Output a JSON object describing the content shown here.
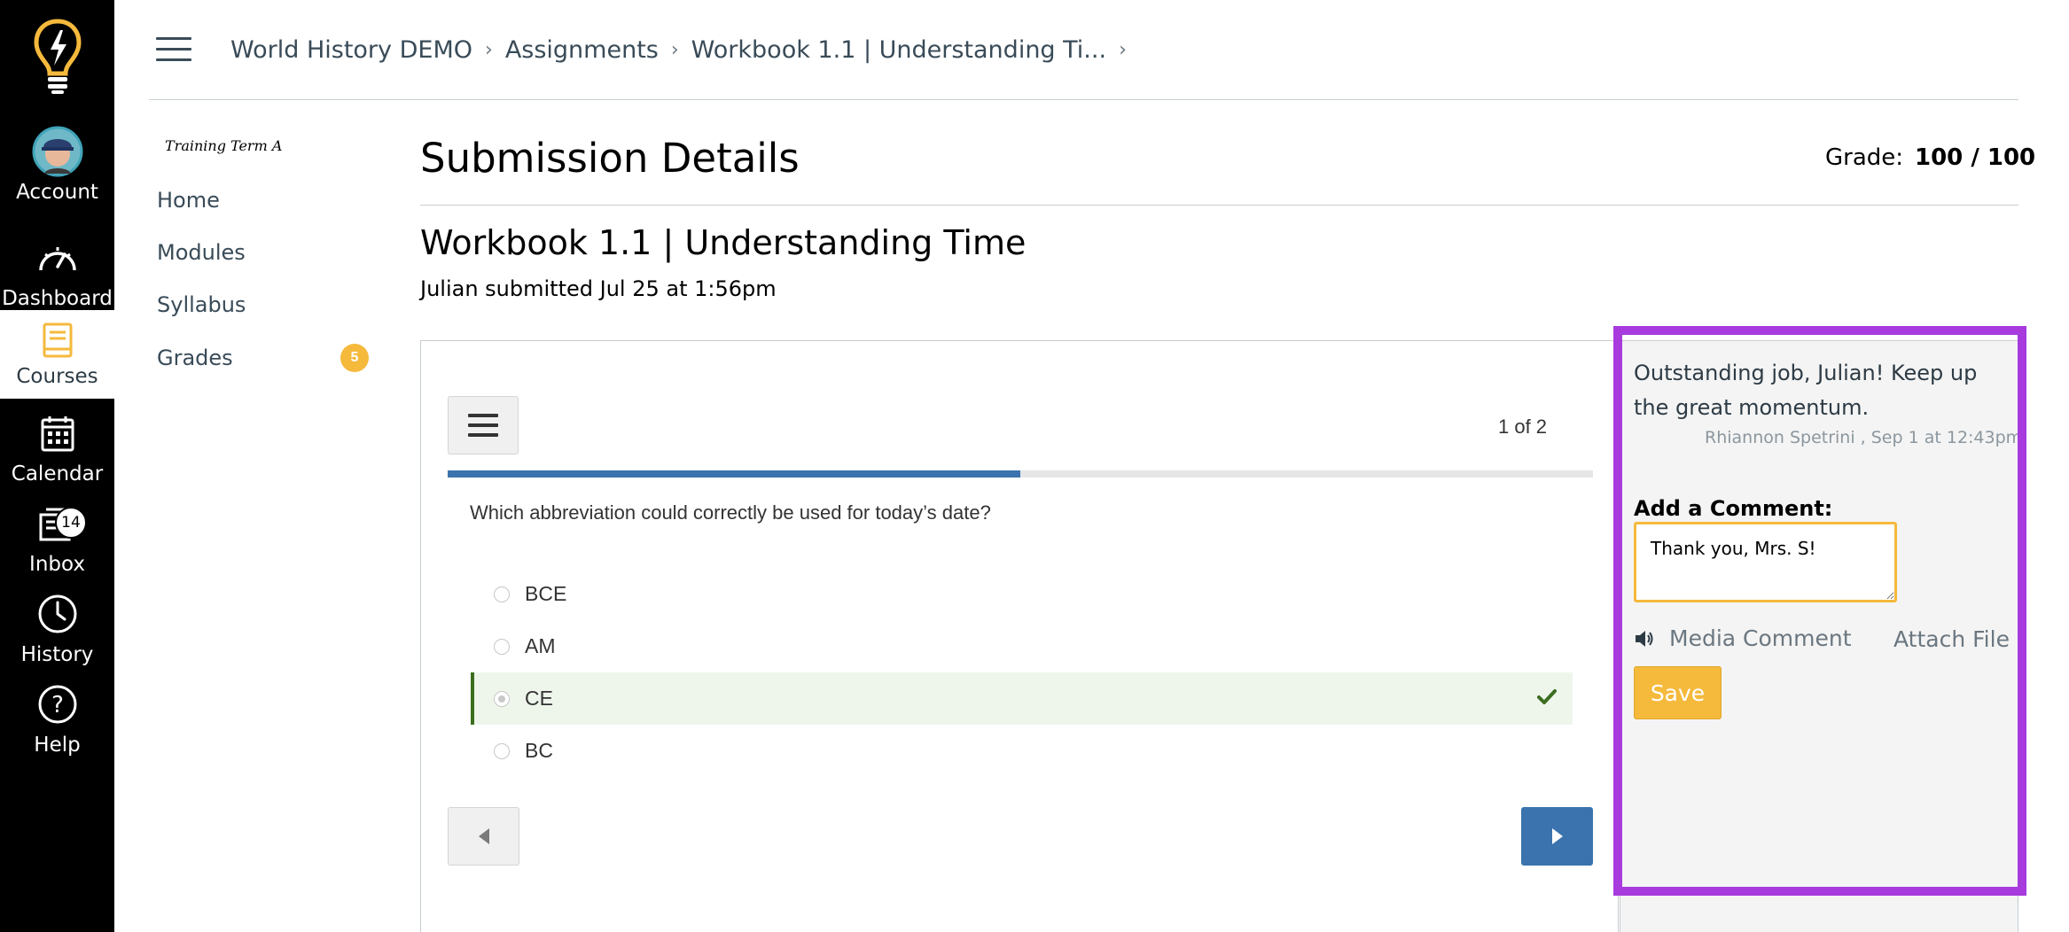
{
  "global_nav": {
    "items": [
      {
        "label": "Account",
        "icon": "avatar"
      },
      {
        "label": "Dashboard",
        "icon": "dashboard-icon"
      },
      {
        "label": "Courses",
        "icon": "courses-icon"
      },
      {
        "label": "Calendar",
        "icon": "calendar-icon"
      },
      {
        "label": "Inbox",
        "icon": "inbox-icon",
        "badge": "14"
      },
      {
        "label": "History",
        "icon": "clock-icon"
      },
      {
        "label": "Help",
        "icon": "help-icon"
      }
    ],
    "active": "Courses"
  },
  "breadcrumb": [
    "World History DEMO",
    "Assignments",
    "Workbook 1.1 | Understanding Ti..."
  ],
  "course_nav": {
    "term": "Training Term A",
    "items": [
      "Home",
      "Modules",
      "Syllabus",
      "Grades"
    ],
    "grades_badge": "5"
  },
  "submission": {
    "title": "Submission Details",
    "grade_label": "Grade:",
    "grade_value": "100 / 100",
    "assignment_title": "Workbook 1.1 | Understanding Time",
    "submitted_line": "Julian submitted Jul 25 at 1:56pm"
  },
  "quiz": {
    "counter": "1 of 2",
    "progress": 0.5,
    "question": "Which abbreviation could correctly be used for today’s date?",
    "answers": [
      {
        "label": "BCE",
        "selected": false,
        "correct": false
      },
      {
        "label": "AM",
        "selected": false,
        "correct": false
      },
      {
        "label": "CE",
        "selected": true,
        "correct": true
      },
      {
        "label": "BC",
        "selected": false,
        "correct": false
      }
    ]
  },
  "comments": {
    "existing_comment": "Outstanding job, Julian! Keep up the great momentum.",
    "existing_meta": "Rhiannon Spetrini , Sep 1 at 12:43pm",
    "add_label": "Add a Comment:",
    "input_value": "Thank you, Mrs. S!",
    "media_comment": "Media Comment",
    "attach_file": "Attach File",
    "save_label": "Save"
  },
  "colors": {
    "nav_bg": "#000000",
    "accent_yellow": "#f5b93c",
    "progress_blue": "#3a73ad",
    "highlight_purple": "#a73bde",
    "correct_green": "#3b6e1f"
  }
}
